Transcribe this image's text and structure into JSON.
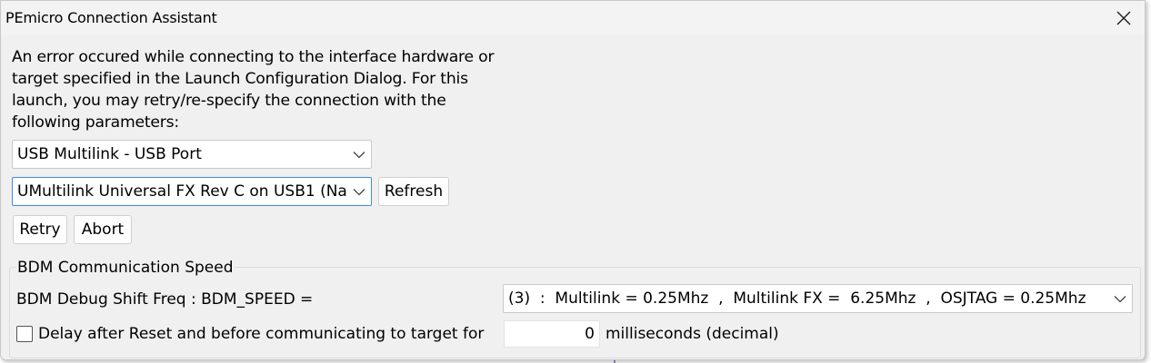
{
  "window": {
    "title": "PEmicro Connection Assistant"
  },
  "message": "An error occured while connecting to the interface hardware or\ntarget specified in the Launch Configuration Dialog. For this\nlaunch, you may retry/re-specify the connection with the\nfollowing parameters:",
  "connection": {
    "interface_selected": "USB Multilink - USB Port",
    "port_selected": "UMultilink Universal FX Rev C on USB1 (Na",
    "refresh_label": "Refresh",
    "retry_label": "Retry",
    "abort_label": "Abort"
  },
  "bdm": {
    "group_title": "BDM Communication Speed",
    "freq_label": "BDM Debug Shift Freq : BDM_SPEED =",
    "freq_selected": "(3)  :  Multilink = 0.25Mhz  ,  Multilink FX =  6.25Mhz  ,  OSJTAG = 0.25Mhz",
    "delay_label": "Delay after Reset and before communicating to target for",
    "delay_checked": false,
    "delay_value": "0",
    "delay_unit": "milliseconds (decimal)"
  }
}
